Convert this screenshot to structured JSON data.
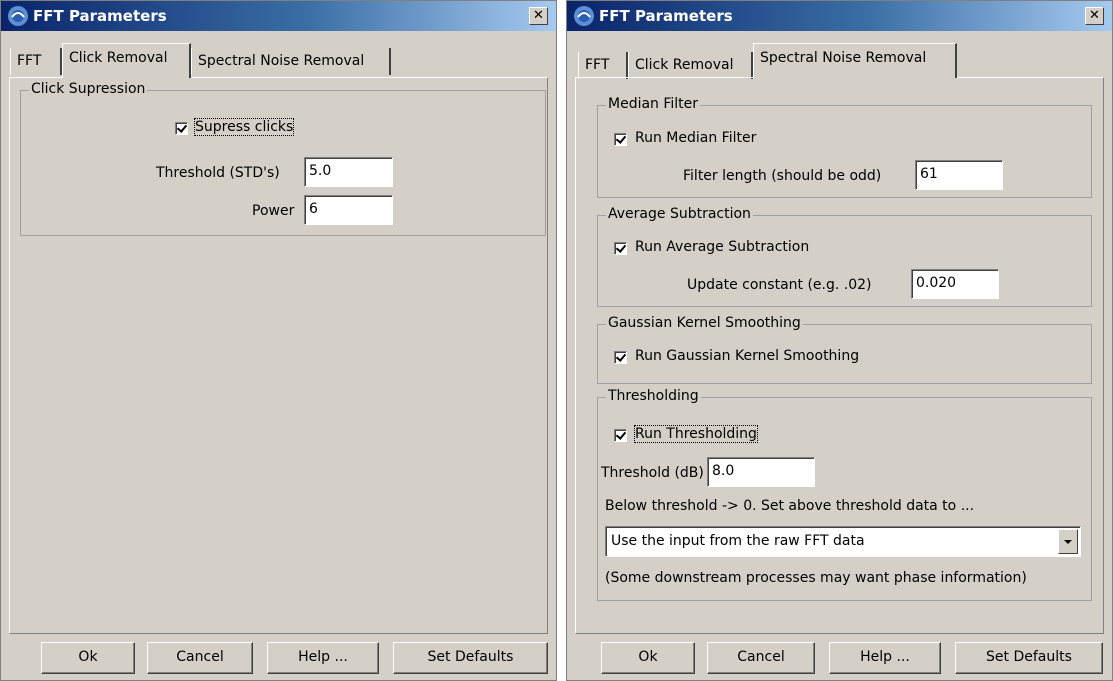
{
  "left_window": {
    "title": "FFT Parameters",
    "close_glyph": "✕",
    "tabs": [
      {
        "label": "FFT",
        "active": false
      },
      {
        "label": "Click Removal",
        "active": true
      },
      {
        "label": "Spectral Noise Removal",
        "active": false
      }
    ],
    "click_suppression": {
      "group_title": "Click Supression",
      "checkbox_label": "Supress clicks",
      "checked": true,
      "threshold_label": "Threshold (STD's)",
      "threshold_value": "5.0",
      "power_label": "Power",
      "power_value": "6"
    },
    "buttons": {
      "ok": "Ok",
      "cancel": "Cancel",
      "help": "Help ...",
      "defaults": "Set Defaults"
    }
  },
  "right_window": {
    "title": "FFT Parameters",
    "close_glyph": "✕",
    "tabs": [
      {
        "label": "FFT",
        "active": false
      },
      {
        "label": "Click Removal",
        "active": false
      },
      {
        "label": "Spectral Noise Removal",
        "active": true
      }
    ],
    "median_filter": {
      "group_title": "Median Filter",
      "checkbox_label": "Run Median Filter",
      "checked": true,
      "length_label": "Filter length (should be odd)",
      "length_value": "61"
    },
    "average_subtraction": {
      "group_title": "Average Subtraction",
      "checkbox_label": "Run Average Subtraction",
      "checked": true,
      "constant_label": "Update constant (e.g. .02)",
      "constant_value": "0.020"
    },
    "gaussian": {
      "group_title": "Gaussian Kernel Smoothing",
      "checkbox_label": "Run Gaussian Kernel Smoothing",
      "checked": true
    },
    "thresholding": {
      "group_title": "Thresholding",
      "checkbox_label": "Run Thresholding",
      "checked": true,
      "threshold_label": "Threshold (dB)",
      "threshold_value": "8.0",
      "below_text": "Below threshold -> 0. Set above threshold data to ...",
      "select_value": "Use the input from the raw FFT data",
      "note": "(Some downstream processes may want phase information)"
    },
    "buttons": {
      "ok": "Ok",
      "cancel": "Cancel",
      "help": "Help ...",
      "defaults": "Set Defaults"
    }
  },
  "icons": {
    "app": "pamguard-icon",
    "close": "close-icon",
    "dropdown": "chevron-down-icon"
  },
  "colors": {
    "title_start": "#0a246a",
    "title_end": "#a6caf0",
    "dialog_bg": "#d4d0c8"
  }
}
